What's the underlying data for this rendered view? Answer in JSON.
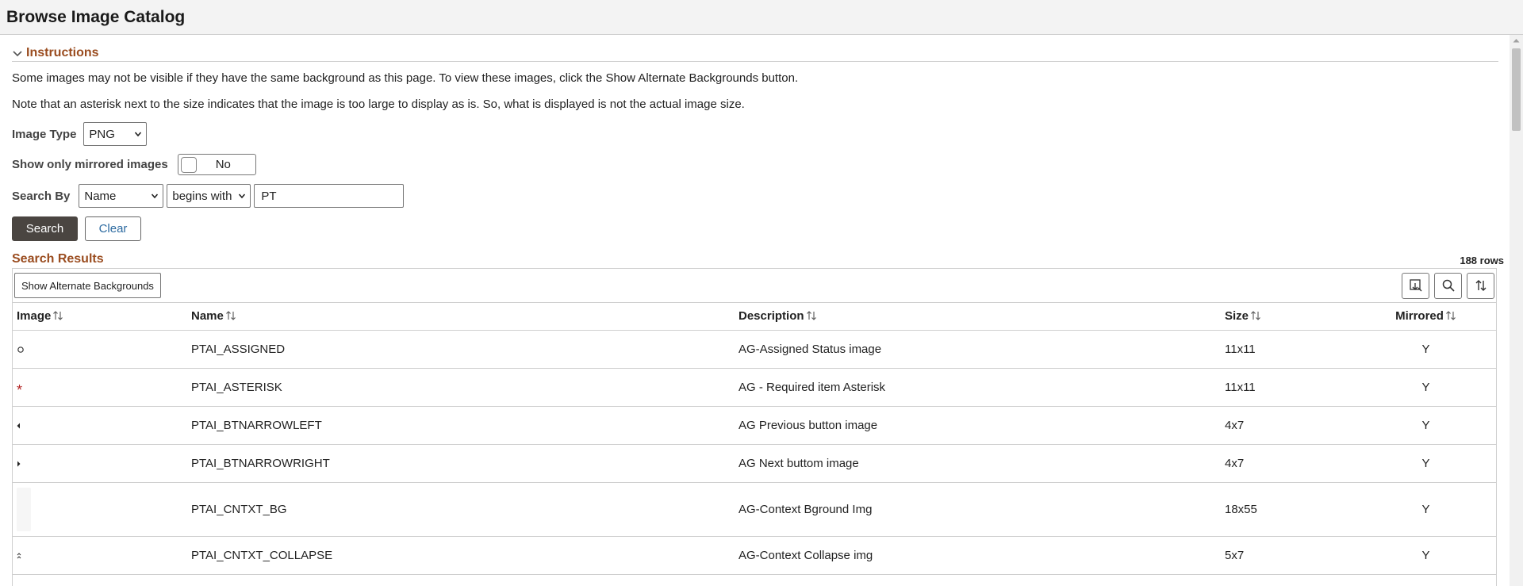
{
  "header": {
    "title": "Browse Image Catalog"
  },
  "instructions": {
    "title": "Instructions",
    "line1": "Some images may not be visible if they have the same background as this page. To view these images, click the Show Alternate Backgrounds button.",
    "line2": "Note that an asterisk next to the size indicates that the image is too large to display as is. So, what is displayed is not the actual image size."
  },
  "form": {
    "image_type_label": "Image Type",
    "image_type_value": "PNG",
    "mirrored_label": "Show only mirrored images",
    "mirrored_value": "No",
    "search_by_label": "Search By",
    "search_field_value": "Name",
    "operator_value": "begins with",
    "search_text": "PT",
    "search_btn": "Search",
    "clear_btn": "Clear"
  },
  "results": {
    "title": "Search Results",
    "row_count": "188 rows",
    "alt_bg_btn": "Show Alternate Backgrounds",
    "columns": [
      "Image",
      "Name",
      "Description",
      "Size",
      "Mirrored"
    ],
    "rows": [
      {
        "icon": "circle-icon",
        "name": "PTAI_ASSIGNED",
        "desc": "AG-Assigned Status image",
        "size": "11x11",
        "mirrored": "Y"
      },
      {
        "icon": "asterisk-icon",
        "name": "PTAI_ASTERISK",
        "desc": "AG - Required item Asterisk",
        "size": "11x11",
        "mirrored": "Y"
      },
      {
        "icon": "arrow-left-icon",
        "name": "PTAI_BTNARROWLEFT",
        "desc": "AG Previous button image",
        "size": "4x7",
        "mirrored": "Y"
      },
      {
        "icon": "arrow-right-icon",
        "name": "PTAI_BTNARROWRIGHT",
        "desc": "AG Next buttom image",
        "size": "4x7",
        "mirrored": "Y"
      },
      {
        "icon": "context-bg-icon",
        "name": "PTAI_CNTXT_BG",
        "desc": "AG-Context Bground Img",
        "size": "18x55",
        "mirrored": "Y"
      },
      {
        "icon": "collapse-icon",
        "name": "PTAI_CNTXT_COLLAPSE",
        "desc": "AG-Context Collapse img",
        "size": "5x7",
        "mirrored": "Y"
      }
    ]
  },
  "colors": {
    "section_title": "#9a4c1f",
    "primary_button": "#4a4541",
    "link": "#2c6aa0"
  }
}
